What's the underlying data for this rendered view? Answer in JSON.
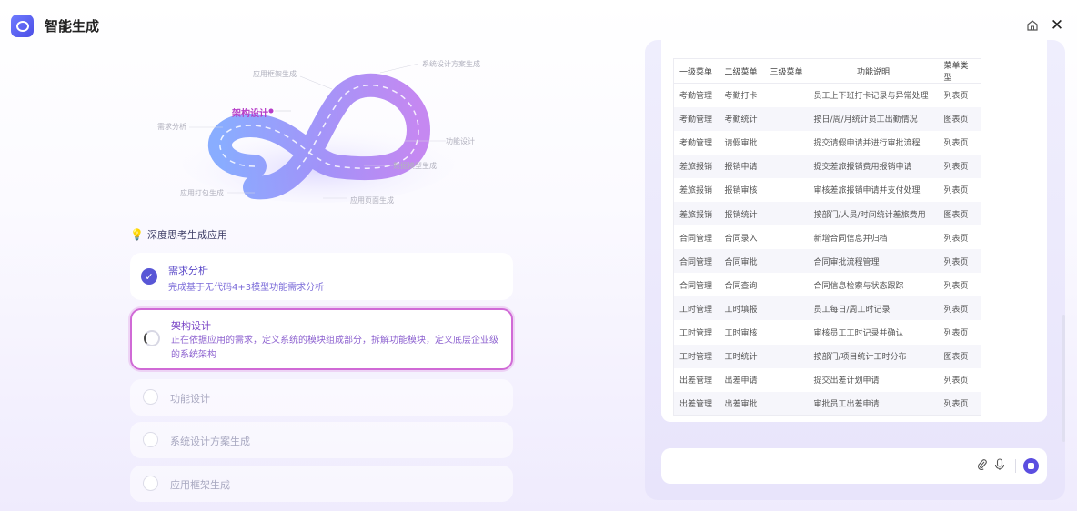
{
  "header": {
    "title": "智能生成"
  },
  "diagram": {
    "labels": {
      "app_framework": "应用框架生成",
      "system_design": "系统设计方案生成",
      "architecture": "架构设计",
      "requirements": "需求分析",
      "function_design": "功能设计",
      "data_model": "数据模型生成",
      "app_package": "应用打包生成",
      "app_page": "应用页面生成"
    }
  },
  "steps": {
    "section_title": "深度思考生成应用",
    "items": [
      {
        "name": "需求分析",
        "desc": "完成基于无代码4+3模型功能需求分析",
        "state": "done"
      },
      {
        "name": "架构设计",
        "desc": "正在依据应用的需求，定义系统的模块组成部分，拆解功能模块，定义底层企业级的系统架构",
        "state": "active"
      },
      {
        "name": "功能设计",
        "state": "pending"
      },
      {
        "name": "系统设计方案生成",
        "state": "pending"
      },
      {
        "name": "应用框架生成",
        "state": "pending"
      }
    ]
  },
  "table": {
    "headers": [
      "一级菜单",
      "二级菜单",
      "三级菜单",
      "功能说明",
      "菜单类型"
    ],
    "rows": [
      [
        "考勤管理",
        "考勤打卡",
        "",
        "员工上下班打卡记录与异常处理",
        "列表页"
      ],
      [
        "考勤管理",
        "考勤统计",
        "",
        "按日/周/月统计员工出勤情况",
        "图表页"
      ],
      [
        "考勤管理",
        "请假审批",
        "",
        "提交请假申请并进行审批流程",
        "列表页"
      ],
      [
        "差旅报销",
        "报销申请",
        "",
        "提交差旅报销费用报销申请",
        "列表页"
      ],
      [
        "差旅报销",
        "报销审核",
        "",
        "审核差旅报销申请并支付处理",
        "列表页"
      ],
      [
        "差旅报销",
        "报销统计",
        "",
        "按部门/人员/时间统计差旅费用",
        "图表页"
      ],
      [
        "合同管理",
        "合同录入",
        "",
        "新增合同信息并归档",
        "列表页"
      ],
      [
        "合同管理",
        "合同审批",
        "",
        "合同审批流程管理",
        "列表页"
      ],
      [
        "合同管理",
        "合同查询",
        "",
        "合同信息检索与状态跟踪",
        "列表页"
      ],
      [
        "工时管理",
        "工时填报",
        "",
        "员工每日/周工时记录",
        "列表页"
      ],
      [
        "工时管理",
        "工时审核",
        "",
        "审核员工工时记录并确认",
        "列表页"
      ],
      [
        "工时管理",
        "工时统计",
        "",
        "按部门/项目统计工时分布",
        "图表页"
      ],
      [
        "出差管理",
        "出差申请",
        "",
        "提交出差计划申请",
        "列表页"
      ],
      [
        "出差管理",
        "出差审批",
        "",
        "审批员工出差申请",
        "列表页"
      ]
    ]
  },
  "icons": {
    "home": "home-icon",
    "close": "close-icon",
    "attach": "paperclip-icon",
    "mic": "microphone-icon",
    "stop": "stop-icon"
  },
  "colors": {
    "accent": "#5856d6",
    "active_border": "#d06ad6"
  }
}
